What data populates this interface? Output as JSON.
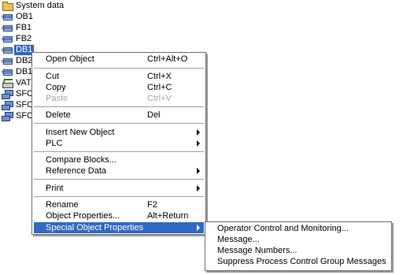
{
  "tree": [
    {
      "label": "System data",
      "icon": "folder-icon",
      "selected": false
    },
    {
      "label": "OB1",
      "icon": "block-icon",
      "selected": false
    },
    {
      "label": "FB1",
      "icon": "block-icon",
      "selected": false
    },
    {
      "label": "FB2",
      "icon": "block-icon",
      "selected": false
    },
    {
      "label": "DB1",
      "icon": "block-icon",
      "selected": true
    },
    {
      "label": "DB2",
      "icon": "block-icon",
      "selected": false
    },
    {
      "label": "DB1",
      "icon": "block-icon",
      "selected": false
    },
    {
      "label": "VAT",
      "icon": "vat-icon",
      "selected": false
    },
    {
      "label": "SFC",
      "icon": "sfc-icon",
      "selected": false
    },
    {
      "label": "SFC",
      "icon": "sfc-icon",
      "selected": false
    },
    {
      "label": "SFC",
      "icon": "sfc-icon",
      "selected": false
    }
  ],
  "context_menu": {
    "open_object": {
      "label": "Open Object",
      "shortcut": "Ctrl+Alt+O"
    },
    "cut": {
      "label": "Cut",
      "shortcut": "Ctrl+X"
    },
    "copy": {
      "label": "Copy",
      "shortcut": "Ctrl+C"
    },
    "paste": {
      "label": "Paste",
      "shortcut": "Ctrl+V",
      "disabled": true
    },
    "delete": {
      "label": "Delete",
      "shortcut": "Del"
    },
    "insert_new_object": {
      "label": "Insert New Object",
      "submenu": true
    },
    "plc": {
      "label": "PLC",
      "submenu": true
    },
    "compare_blocks": {
      "label": "Compare Blocks..."
    },
    "reference_data": {
      "label": "Reference Data",
      "submenu": true
    },
    "print": {
      "label": "Print",
      "submenu": true
    },
    "rename": {
      "label": "Rename",
      "shortcut": "F2"
    },
    "object_properties": {
      "label": "Object Properties...",
      "shortcut": "Alt+Return"
    },
    "special_object_properties": {
      "label": "Special Object Properties",
      "submenu": true,
      "highlighted": true
    }
  },
  "submenu": {
    "operator_control": {
      "label": "Operator Control and Monitoring..."
    },
    "message": {
      "label": "Message..."
    },
    "message_numbers": {
      "label": "Message Numbers..."
    },
    "suppress_messages": {
      "label": "Suppress Process Control Group Messages"
    }
  },
  "colors": {
    "highlight": "#316ac5",
    "disabled_text": "#a6a6a6"
  }
}
